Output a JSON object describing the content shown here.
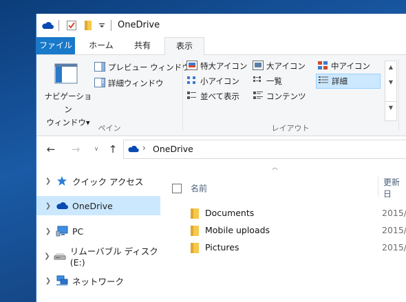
{
  "window": {
    "title": "OneDrive"
  },
  "tabs": {
    "file": "ファイル",
    "home": "ホーム",
    "share": "共有",
    "view": "表示"
  },
  "ribbon": {
    "panes_group": {
      "label": "ペイン",
      "nav_pane_line1": "ナビゲーション",
      "nav_pane_line2": "ウィンドウ▾",
      "preview_pane": "プレビュー ウィンドウ",
      "details_pane": "詳細ウィンドウ"
    },
    "layout_group": {
      "label": "レイアウト",
      "extra_large_icons": "特大アイコン",
      "large_icons": "大アイコン",
      "medium_icons": "中アイコン",
      "small_icons": "小アイコン",
      "list": "一覧",
      "details": "詳細",
      "tiles": "並べて表示",
      "content": "コンテンツ",
      "selected": "詳細"
    }
  },
  "address": {
    "path": "OneDrive"
  },
  "nav_pane": {
    "items": [
      {
        "label": "クイック アクセス",
        "icon": "star-icon"
      },
      {
        "label": "OneDrive",
        "icon": "onedrive-cloud-icon",
        "selected": true
      },
      {
        "label": "PC",
        "icon": "pc-icon"
      },
      {
        "label": "リムーバブル ディスク (E:)",
        "icon": "drive-icon"
      },
      {
        "label": "ネットワーク",
        "icon": "network-icon"
      }
    ]
  },
  "file_list": {
    "columns": {
      "name": "名前",
      "date": "更新日"
    },
    "rows": [
      {
        "name": "Documents",
        "date": "2015/"
      },
      {
        "name": "Mobile uploads",
        "date": "2015/"
      },
      {
        "name": "Pictures",
        "date": "2015/"
      }
    ]
  },
  "colors": {
    "accent": "#1979ca",
    "selection": "#cce8ff",
    "folder": "#f6c94a"
  }
}
